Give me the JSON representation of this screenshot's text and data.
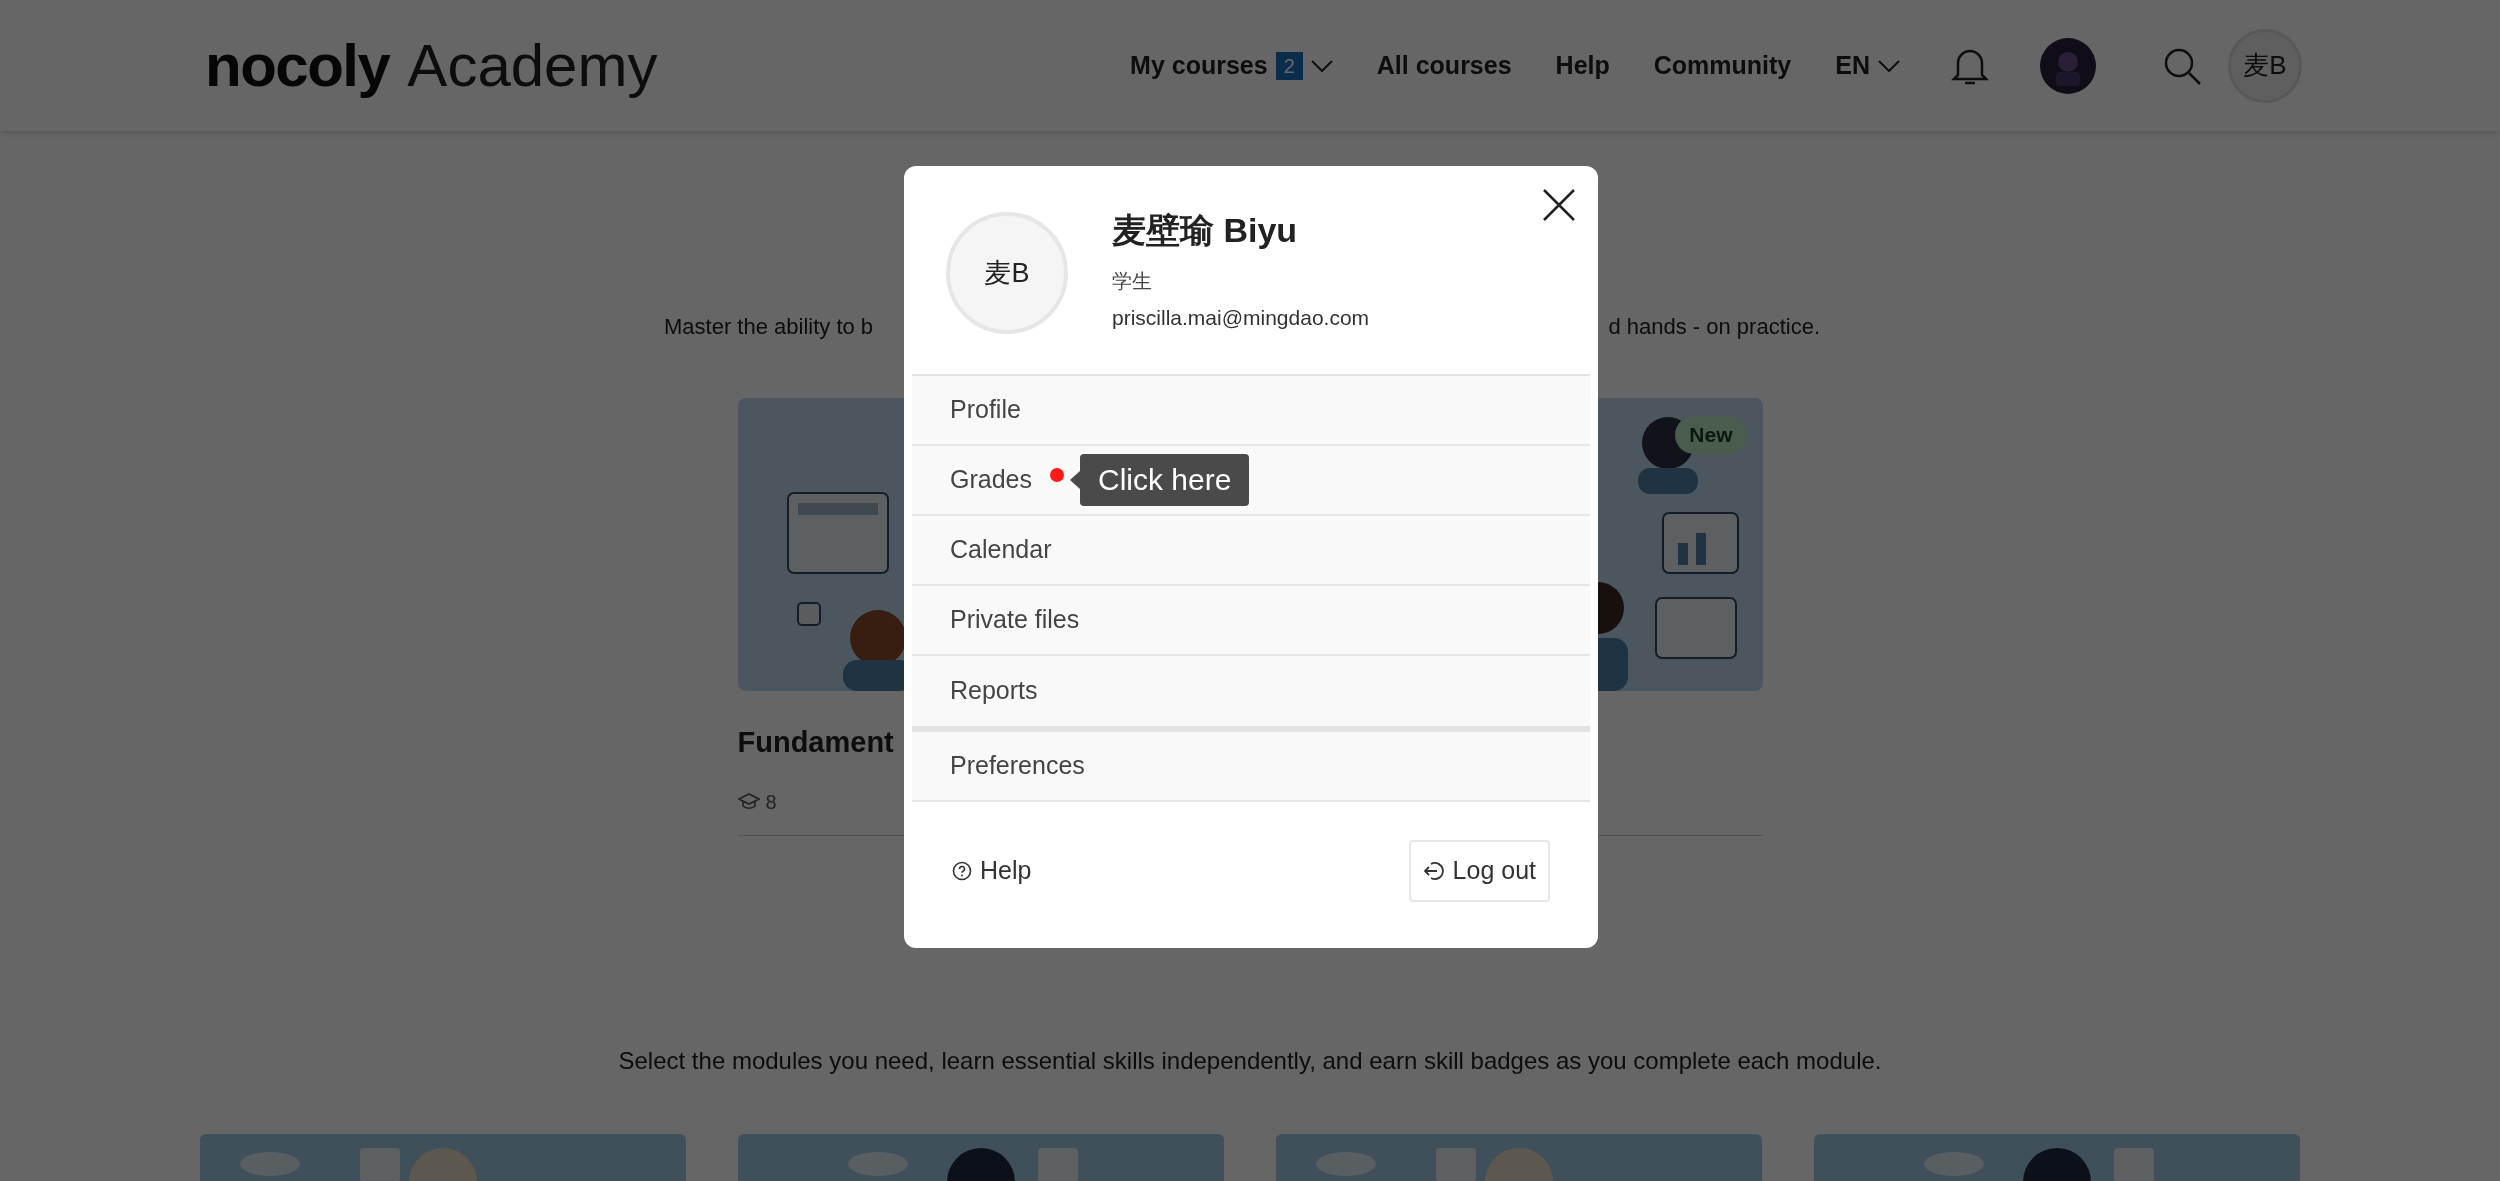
{
  "header": {
    "logo_brand": "nocoly",
    "logo_product": "Academy",
    "nav": [
      {
        "label": "My courses",
        "badge": "2",
        "dropdown": true
      },
      {
        "label": "All courses"
      },
      {
        "label": "Help"
      },
      {
        "label": "Community"
      }
    ],
    "language": "EN",
    "user_initials": "麦B"
  },
  "page": {
    "intro_left": "Master the ability to b",
    "intro_right": "d hands - on practice.",
    "course": {
      "badge": "New",
      "title": "Fundament",
      "count": "8"
    },
    "modules_intro": "Select the modules you need, learn essential skills independently, and earn skill badges as you complete each module."
  },
  "user_menu": {
    "initials": "麦B",
    "name": "麦壁瑜 Biyu",
    "role": "学生",
    "email": "priscilla.mai@mingdao.com",
    "sections": [
      {
        "items": [
          {
            "label": "Profile",
            "notification": false
          },
          {
            "label": "Grades",
            "notification": true,
            "tooltip": "Click here"
          },
          {
            "label": "Calendar",
            "notification": false
          },
          {
            "label": "Private files",
            "notification": false
          },
          {
            "label": "Reports",
            "notification": false
          }
        ]
      },
      {
        "items": [
          {
            "label": "Preferences",
            "notification": false
          }
        ]
      }
    ],
    "help": "Help",
    "logout": "Log out"
  }
}
